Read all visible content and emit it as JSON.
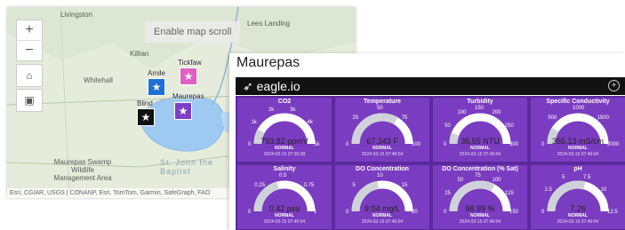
{
  "map": {
    "tooltip": "Enable map scroll",
    "zoom_in": "+",
    "zoom_out": "−",
    "labels": {
      "livingston": "Livingston",
      "lees_landing": "Lees Landing",
      "killian": "Killian",
      "whitehall": "Whitehall",
      "maurepas_swamp": "Maurepas Swamp Wildlife Management Area",
      "st_john": "St. John the Baptist",
      "lake": "Maurepas"
    },
    "pins": [
      {
        "name": "Amile",
        "color": "#1f6fd6"
      },
      {
        "name": "Tickfaw",
        "color": "#e05fc0"
      },
      {
        "name": "Maurepas",
        "color": "#7d3fc8"
      },
      {
        "name": "Blind",
        "color": "#111111"
      }
    ],
    "attribution": "Esri, CGIAR, USGS | CONANP, Esri, TomTom, Garmin, SafeGraph, FAO"
  },
  "dashboard": {
    "title": "Maurepas",
    "logo": "eagle.io",
    "tiles": [
      {
        "title": "CO2",
        "value": "793.82 ppmV",
        "status": "NORMAL",
        "date": "2024-03-15 07:20:28",
        "fraction": 0.16,
        "ticks": [
          "0",
          "1k",
          "2k",
          "3k",
          "4k",
          "5k"
        ]
      },
      {
        "title": "Temperature",
        "value": "67.343 F",
        "status": "NORMAL",
        "date": "2024-03-15 07:40:04",
        "fraction": 0.67,
        "ticks": [
          "0",
          "25",
          "50",
          "75",
          "100"
        ]
      },
      {
        "title": "Turbidity",
        "value": "36.55 NTU",
        "status": "NORMAL",
        "date": "2024-03-15 07:40:04",
        "fraction": 0.12,
        "ticks": [
          "0",
          "50",
          "100",
          "150",
          "200",
          "250",
          "300"
        ]
      },
      {
        "title": "Specific Conductivity",
        "value": "355.13 mS/cm",
        "status": "NORMAL",
        "date": "2024-03-15 07:40:04",
        "fraction": 0.18,
        "ticks": [
          "0",
          "500",
          "1000",
          "1500",
          "2000"
        ]
      },
      {
        "title": "Salinity",
        "value": "0.42 psu",
        "status": "NORMAL",
        "date": "2024-03-15 07:40:04",
        "fraction": 0.42,
        "ticks": [
          "0",
          "0.25",
          "0.5",
          "0.75",
          "1"
        ]
      },
      {
        "title": "DO Concentration",
        "value": "9.04 mg/L",
        "status": "NORMAL",
        "date": "2024-03-15 07:40:04",
        "fraction": 0.45,
        "ticks": [
          "0",
          "5",
          "10",
          "15",
          "20"
        ]
      },
      {
        "title": "DO Concentration (% Sat)",
        "value": "98.99 %",
        "status": "NORMAL",
        "date": "2024-03-15 07:40:04",
        "fraction": 0.66,
        "ticks": [
          "0",
          "25",
          "50",
          "75",
          "100",
          "125",
          "150"
        ]
      },
      {
        "title": "pH",
        "value": "7.26",
        "status": "NORMAL",
        "date": "2024-03-15 07:40:04",
        "fraction": 0.58,
        "ticks": [
          "0",
          "2.5",
          "5",
          "7.5",
          "10",
          "12.5"
        ]
      }
    ]
  }
}
